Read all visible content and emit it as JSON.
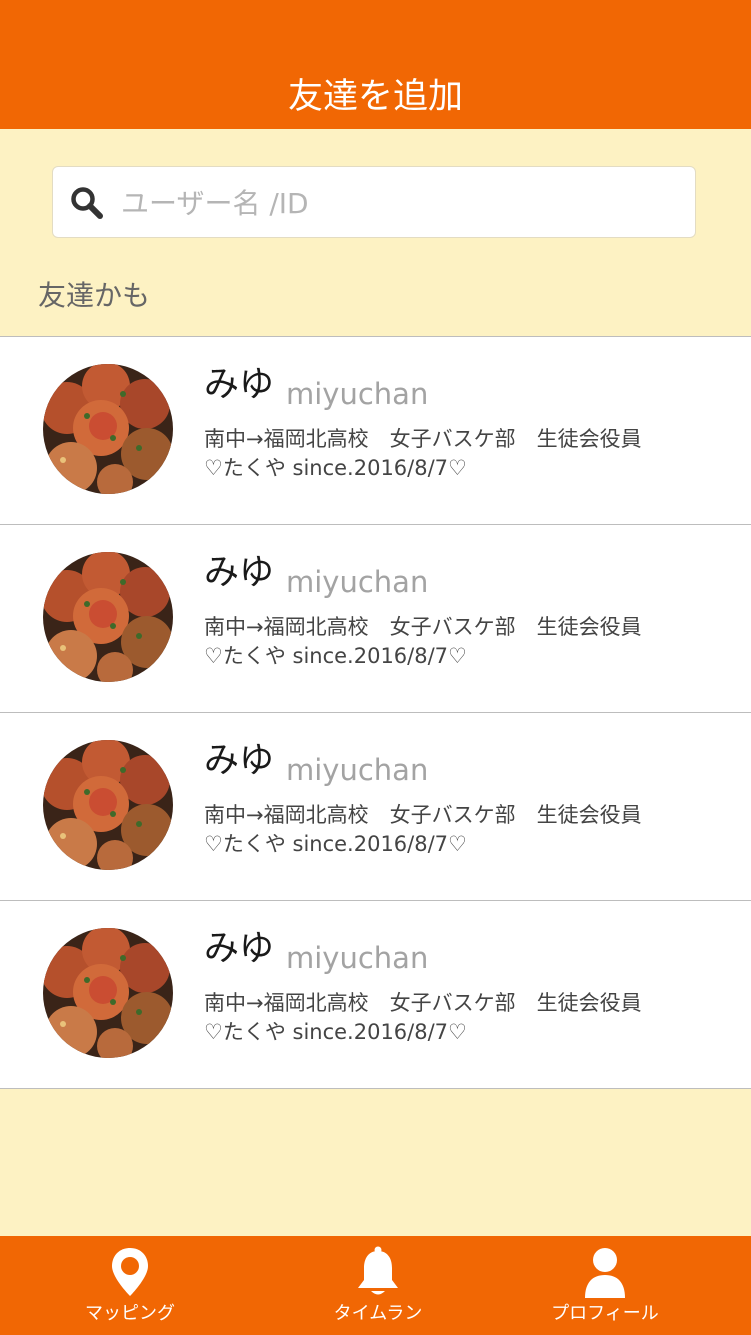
{
  "header": {
    "title": "友達を追加"
  },
  "search": {
    "placeholder": "ユーザー名 /ID",
    "value": ""
  },
  "section": {
    "label": "友達かも"
  },
  "suggestions": [
    {
      "name": "みゆ",
      "user_id": "miyuchan",
      "bio_line1": "南中→福岡北高校　女子バスケ部　生徒会役員",
      "bio_line2": "♡たくや since.2016/8/7♡"
    },
    {
      "name": "みゆ",
      "user_id": "miyuchan",
      "bio_line1": "南中→福岡北高校　女子バスケ部　生徒会役員",
      "bio_line2": "♡たくや since.2016/8/7♡"
    },
    {
      "name": "みゆ",
      "user_id": "miyuchan",
      "bio_line1": "南中→福岡北高校　女子バスケ部　生徒会役員",
      "bio_line2": "♡たくや since.2016/8/7♡"
    },
    {
      "name": "みゆ",
      "user_id": "miyuchan",
      "bio_line1": "南中→福岡北高校　女子バスケ部　生徒会役員",
      "bio_line2": "♡たくや since.2016/8/7♡"
    }
  ],
  "tabbar": {
    "items": [
      {
        "label": "マッピング",
        "icon": "map-pin-icon"
      },
      {
        "label": "タイムラン",
        "icon": "bell-icon"
      },
      {
        "label": "プロフィール",
        "icon": "person-icon"
      }
    ]
  },
  "colors": {
    "accent": "#f16704",
    "background": "#fdf2c3",
    "card": "#ffffff"
  }
}
